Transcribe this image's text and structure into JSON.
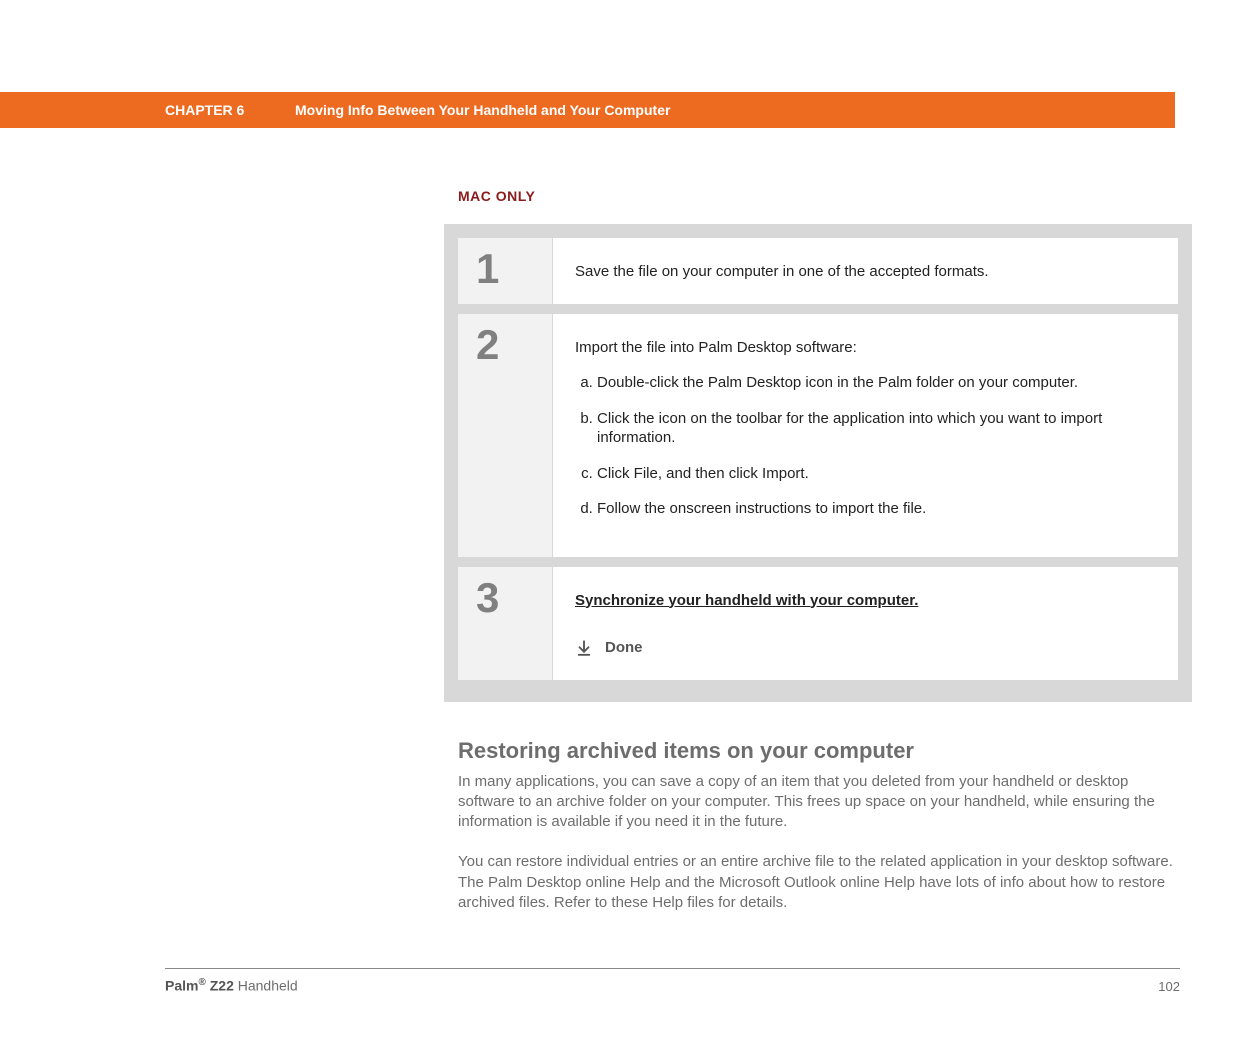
{
  "header": {
    "chapter": "CHAPTER 6",
    "title": "Moving Info Between Your Handheld and Your Computer"
  },
  "mac_only_label": "MAC ONLY",
  "steps": {
    "s1": {
      "num": "1",
      "text": "Save the file on your computer in one of the accepted formats."
    },
    "s2": {
      "num": "2",
      "intro": "Import the file into Palm Desktop software:",
      "a": "Double-click the Palm Desktop icon in the Palm folder on your computer.",
      "b": "Click the icon on the toolbar for the application into which you want to import information.",
      "c": "Click File, and then click Import.",
      "d": "Follow the onscreen instructions to import the file."
    },
    "s3": {
      "num": "3",
      "link": "Synchronize your handheld with your computer.",
      "done": "Done"
    }
  },
  "section": {
    "heading": "Restoring archived items on your computer",
    "para1": "In many applications, you can save a copy of an item that you deleted from your handheld or desktop software to an archive folder on your computer. This frees up space on your handheld, while ensuring the information is available if you need it in the future.",
    "para2": "You can restore individual entries or an entire archive file to the related application in your desktop software. The Palm Desktop online Help and the Microsoft Outlook online Help have lots of info about how to restore archived files. Refer to these Help files for details."
  },
  "footer": {
    "brand_prefix": "Palm",
    "brand_reg": "®",
    "brand_model": " Z22",
    "brand_suffix": " Handheld",
    "page_number": "102"
  }
}
